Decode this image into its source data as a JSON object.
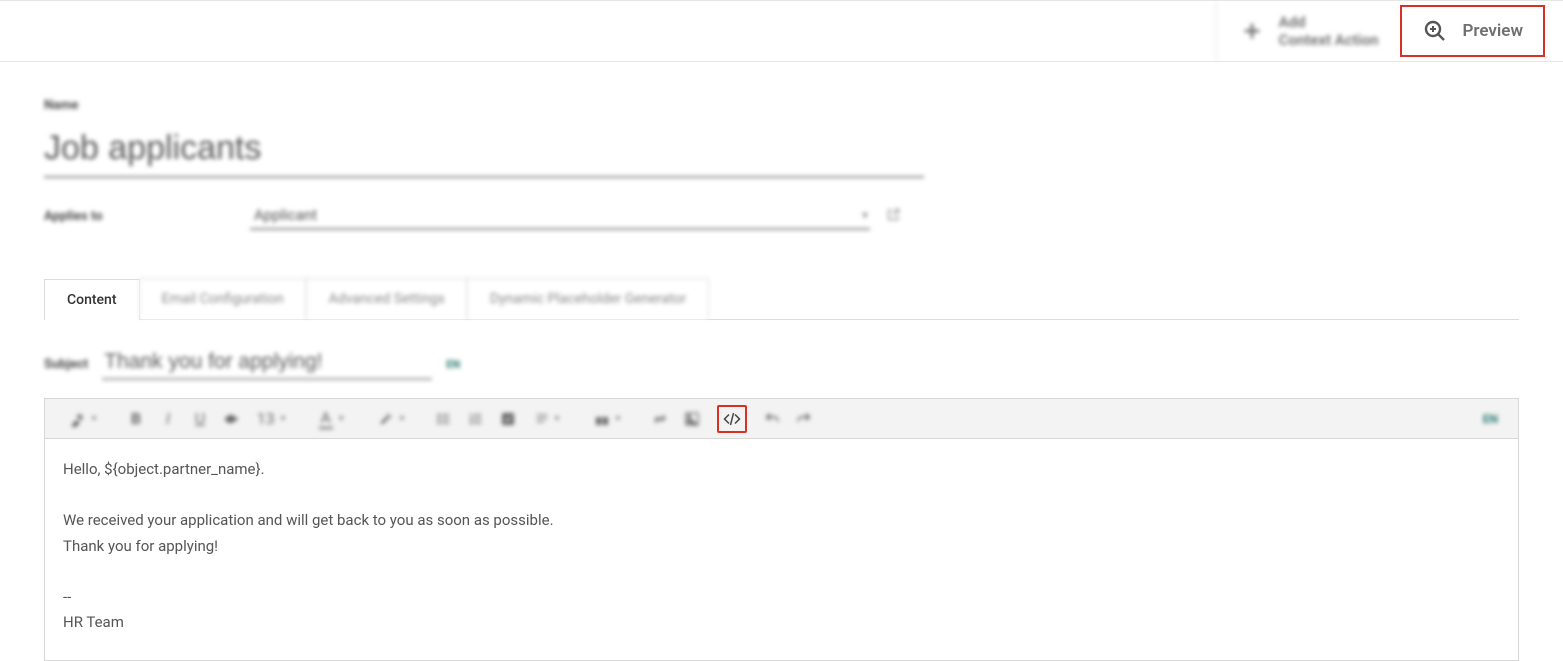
{
  "toolbar": {
    "add_context": {
      "line1": "Add",
      "line2": "Context Action"
    },
    "preview_label": "Preview"
  },
  "form": {
    "name_label": "Name",
    "name_value": "Job applicants",
    "applies_label": "Applies to",
    "applies_value": "Applicant"
  },
  "tabs": [
    {
      "label": "Content",
      "active": true
    },
    {
      "label": "Email Configuration",
      "active": false
    },
    {
      "label": "Advanced Settings",
      "active": false
    },
    {
      "label": "Dynamic Placeholder Generator",
      "active": false
    }
  ],
  "subject": {
    "label": "Subject",
    "value": "Thank you for applying!",
    "lang": "EN"
  },
  "editor_toolbar": {
    "font_size": "13",
    "font_letter": "A",
    "lang": "EN"
  },
  "body": {
    "line1": "Hello, ${object.partner_name}.",
    "line2": "",
    "line3": "We received your application and will get back to you as soon as possible.",
    "line4": "Thank you for applying!",
    "line5": "",
    "line6": "--",
    "line7": "HR Team"
  }
}
